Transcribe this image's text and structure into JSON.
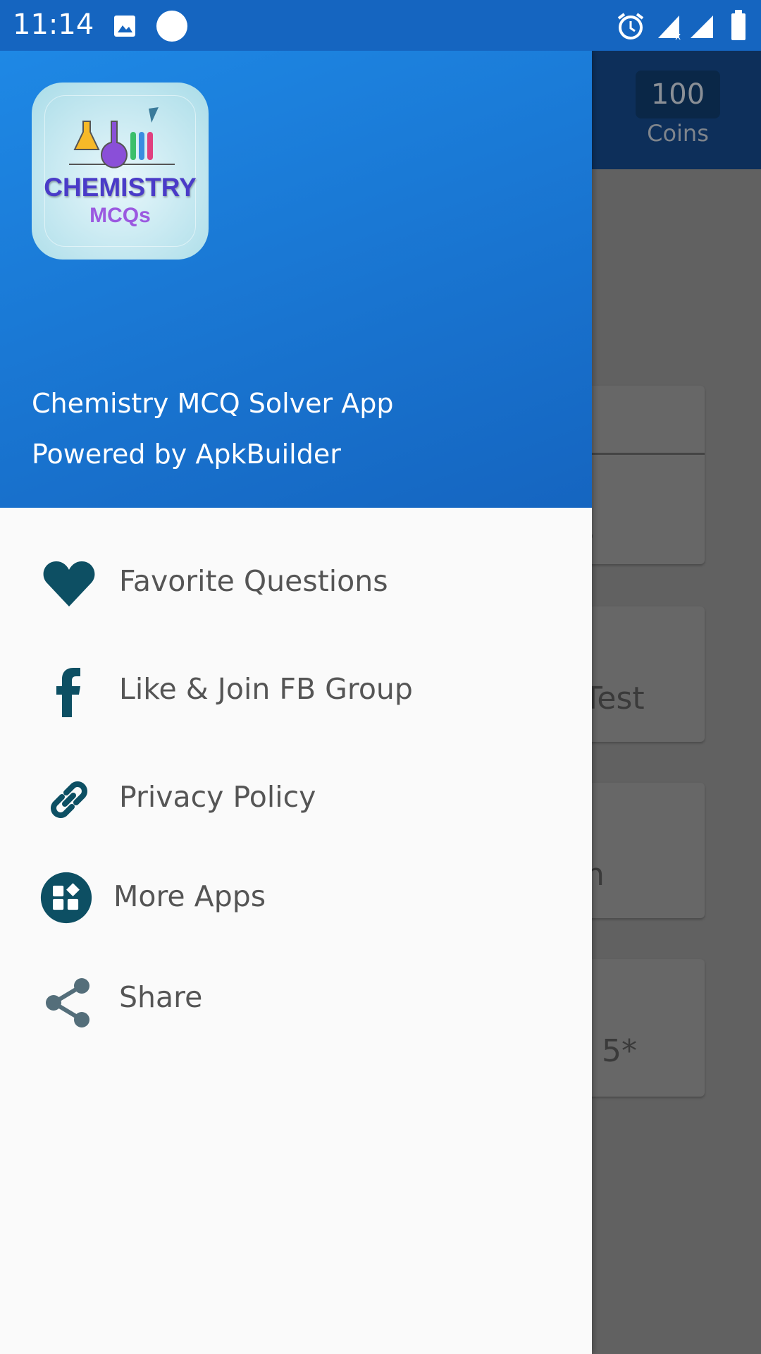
{
  "status_bar": {
    "time": "11:14",
    "icons": [
      "image-icon",
      "circle-icon",
      "alarm-icon",
      "signal-no-sim-icon",
      "signal-icon",
      "battery-icon"
    ]
  },
  "background": {
    "coins_value": "100",
    "coins_label": "Coins",
    "cards": [
      "s",
      "Test",
      "n",
      "5*"
    ]
  },
  "drawer": {
    "app_name": "Chemistry MCQ Solver App",
    "powered_by": "Powered by ApkBuilder",
    "logo_text": {
      "title": "CHEMISTRY",
      "subtitle": "MCQs"
    },
    "items": [
      {
        "label": "Favorite Questions",
        "icon": "heart-icon"
      },
      {
        "label": "Like & Join FB Group",
        "icon": "facebook-icon"
      },
      {
        "label": "Privacy Policy",
        "icon": "link-icon"
      },
      {
        "label": "More Apps",
        "icon": "apps-icon"
      },
      {
        "label": "Share",
        "icon": "share-icon"
      }
    ]
  },
  "colors": {
    "header": "#1976d2",
    "icon": "#0d4f63",
    "scrim": "#616161"
  }
}
